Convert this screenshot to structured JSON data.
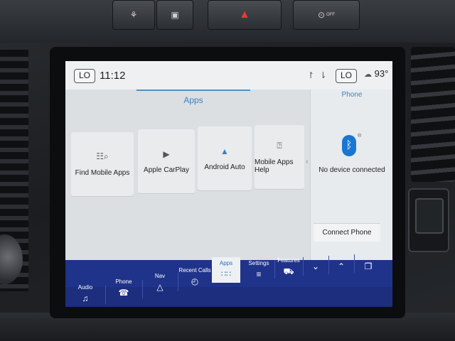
{
  "hardware_buttons": [
    {
      "label": "",
      "icon": "seat-belt-icon"
    },
    {
      "label": "",
      "icon": "camera-icon"
    },
    {
      "label": "",
      "icon": "hazard-icon"
    },
    {
      "label": "OFF",
      "icon": "traction-off-icon"
    }
  ],
  "statusbar": {
    "left_climate": "LO",
    "time": "11:12",
    "icons": "↾ ⇂",
    "right_climate": "LO",
    "temperature": "93°",
    "weather_icon": "cloud-icon"
  },
  "apps": {
    "title": "Apps",
    "tiles": [
      {
        "label": "Find Mobile Apps",
        "icon": "search-apps-icon"
      },
      {
        "label": "Apple CarPlay",
        "icon": "carplay-icon"
      },
      {
        "label": "Android Auto",
        "icon": "android-auto-icon"
      },
      {
        "label": "Mobile Apps Help",
        "icon": "help-icon"
      }
    ]
  },
  "phone": {
    "title": "Phone",
    "status": "No device connected",
    "connect_label": "Connect Phone",
    "icon": "bluetooth-icon"
  },
  "navbar": {
    "items": [
      {
        "label": "Audio",
        "icon": "music-note-icon"
      },
      {
        "label": "Phone",
        "icon": "phone-icon"
      },
      {
        "label": "Nav",
        "icon": "navigation-icon"
      },
      {
        "label": "Recent Calls",
        "icon": "recent-calls-icon"
      },
      {
        "label": "Apps",
        "icon": "apps-grid-icon"
      },
      {
        "label": "Settings",
        "icon": "settings-sliders-icon"
      },
      {
        "label": "Features",
        "icon": "truck-icon"
      },
      {
        "label": "",
        "icon": "chevron-down-icon"
      },
      {
        "label": "",
        "icon": "chevron-up-icon"
      },
      {
        "label": "",
        "icon": "cards-icon"
      }
    ]
  }
}
